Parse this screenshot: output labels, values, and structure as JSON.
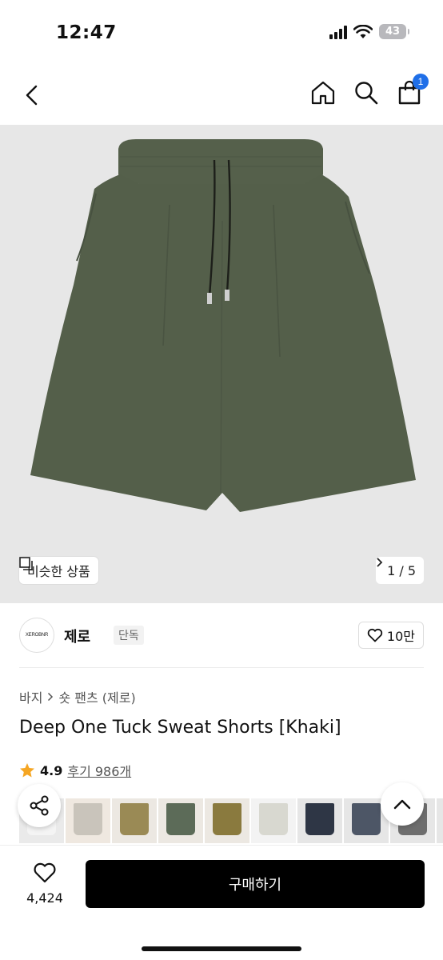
{
  "status": {
    "time": "12:47",
    "battery": "43"
  },
  "nav": {
    "cart_count": "1"
  },
  "hero": {
    "similar_label": "비슷한 상품",
    "pager": "1 / 5",
    "product_color": "#545f4a"
  },
  "brand": {
    "logo_text": "XEROBNR",
    "name": "제로",
    "tag": "단독",
    "likes": "10만"
  },
  "breadcrumb": {
    "category": "바지",
    "sub": "숏 팬츠 (제로)"
  },
  "product": {
    "title": "Deep One Tuck Sweat Shorts [Khaki]",
    "rating": "4.9",
    "reviews": "후기 986개"
  },
  "thumbnails": [
    {
      "color": "#f4f4f4",
      "bg": "#eaeaea"
    },
    {
      "color": "#c9c4bb",
      "bg": "#efe8e0"
    },
    {
      "color": "#9a8a55",
      "bg": "#ece8e2"
    },
    {
      "color": "#5c6b58",
      "bg": "#ece8e2"
    },
    {
      "color": "#8a7a3e",
      "bg": "#ece8e2"
    },
    {
      "color": "#d8d8d0",
      "bg": "#f3f3f3"
    },
    {
      "color": "#2e3645",
      "bg": "#e6e6e6"
    },
    {
      "color": "#4d5666",
      "bg": "#e6e6e6"
    },
    {
      "color": "#6e6e6e",
      "bg": "#e6e6e6"
    },
    {
      "color": "#444a3c",
      "bg": "#e6e6e6"
    }
  ],
  "bottom": {
    "wish_count": "4,424",
    "buy_label": "구매하기"
  },
  "colors": {
    "accent": "#1f6fe8",
    "star": "#f5a623"
  }
}
